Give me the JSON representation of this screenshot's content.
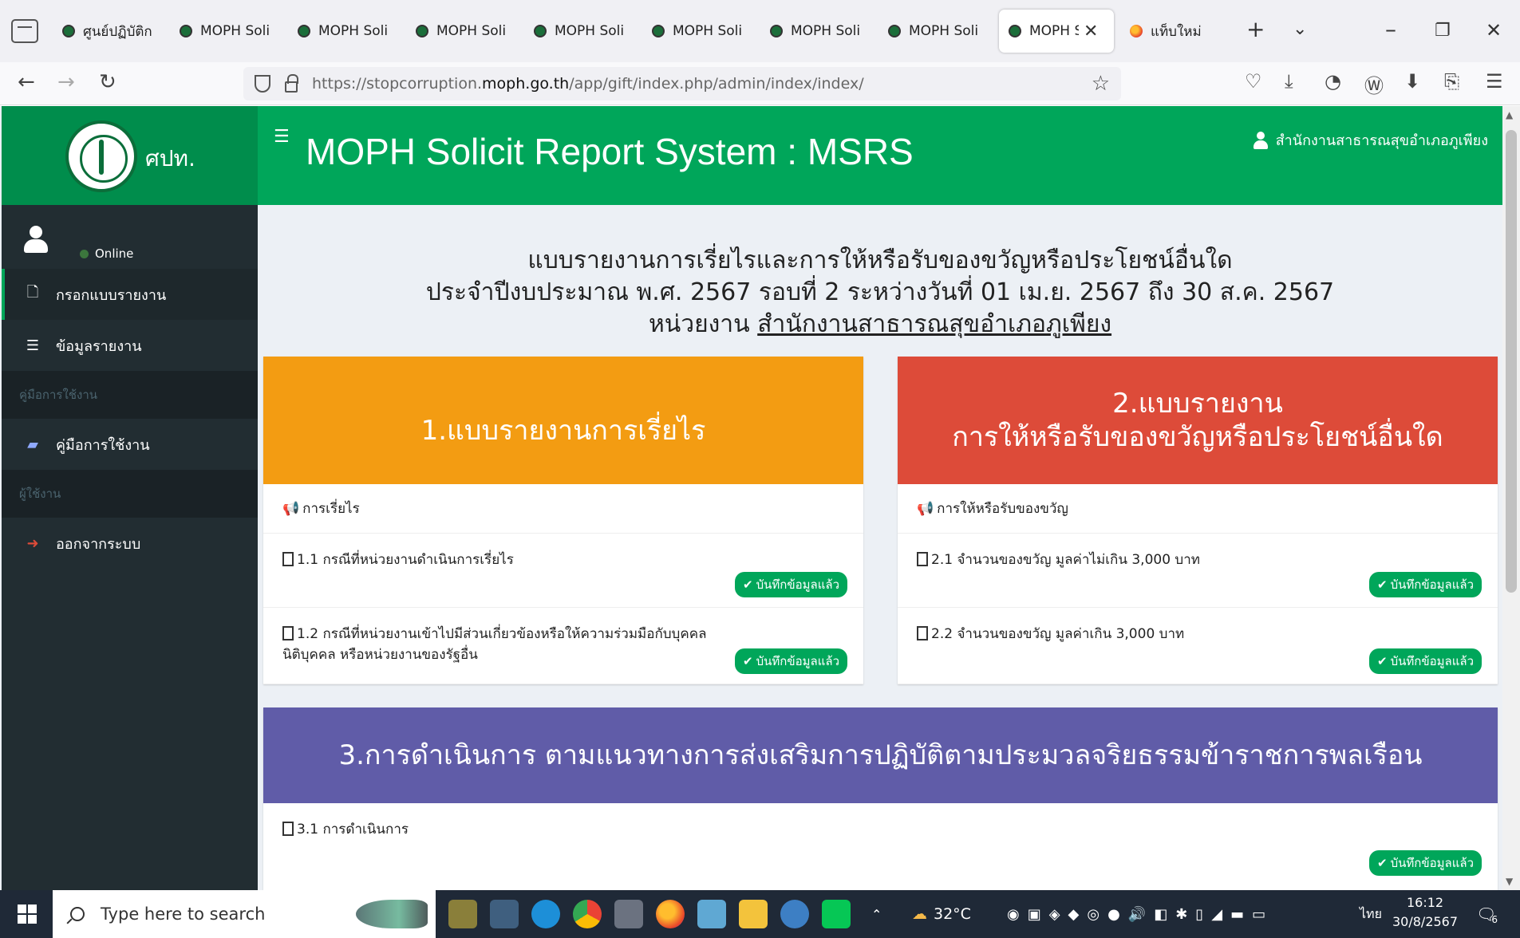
{
  "browser": {
    "tabs": [
      {
        "title": "ศูนย์ปฏิบัติการ",
        "active": false
      },
      {
        "title": "MOPH Solicit",
        "active": false
      },
      {
        "title": "MOPH Solicit",
        "active": false
      },
      {
        "title": "MOPH Solicit",
        "active": false
      },
      {
        "title": "MOPH Solicit",
        "active": false
      },
      {
        "title": "MOPH Solicit",
        "active": false
      },
      {
        "title": "MOPH Solicit",
        "active": false
      },
      {
        "title": "MOPH Solicit",
        "active": false
      },
      {
        "title": "MOPH S",
        "active": true
      },
      {
        "title": "แท็บใหม่",
        "active": false
      }
    ],
    "url_prefix": "https://stopcorruption.",
    "url_host": "moph.go.th",
    "url_path": "/app/gift/index.php/admin/index/index/"
  },
  "sidebar": {
    "logo_text": "ศปท.",
    "status": "Online",
    "items": [
      {
        "label": "กรอกแบบรายงาน",
        "icon": "file-icon",
        "active": true
      },
      {
        "label": "ข้อมูลรายงาน",
        "icon": "list-icon",
        "active": false
      }
    ],
    "section_manual": "คู่มือการใช้งาน",
    "manual_item": "คู่มือการใช้งาน",
    "section_user": "ผู้ใช้งาน",
    "logout_item": "ออกจากระบบ"
  },
  "header": {
    "title": "MOPH Solicit Report System : MSRS",
    "user": "สำนักงานสาธารณสุขอำเภอภูเพียง"
  },
  "report": {
    "line1": "แบบรายงานการเรี่ยไรและการให้หรือรับของขวัญหรือประโยชน์อื่นใด",
    "line2": "ประจำปีงบประมาณ พ.ศ. 2567 รอบที่ 2 ระหว่างวันที่ 01 เม.ย. 2567 ถึง 30 ส.ค. 2567",
    "line3_label": "หน่วยงาน",
    "line3_org": "สำนักงานสาธารณสุขอำเภอภูเพียง"
  },
  "sections": {
    "s1": {
      "title": "1.แบบรายงานการเรี่ยไร",
      "color": "#f39c12",
      "sub": "การเรี่ยไร",
      "rows": [
        {
          "text": "1.1 กรณีที่หน่วยงานดำเนินการเรี่ยไร",
          "badge": "บันทึกข้อมูลแล้ว"
        },
        {
          "text": "1.2 กรณีที่หน่วยงานเข้าไปมีส่วนเกี่ยวข้องหรือให้ความร่วมมือกับบุคคล นิติบุคคล หรือหน่วยงานของรัฐอื่น",
          "badge": "บันทึกข้อมูลแล้ว"
        }
      ]
    },
    "s2": {
      "title_line1": "2.แบบรายงาน",
      "title_line2": "การให้หรือรับของขวัญหรือประโยชน์อื่นใด",
      "color": "#dd4b39",
      "sub": "การให้หรือรับของขวัญ",
      "rows": [
        {
          "text": "2.1 จำนวนของขวัญ มูลค่าไม่เกิน 3,000 บาท",
          "badge": "บันทึกข้อมูลแล้ว"
        },
        {
          "text": "2.2 จำนวนของขวัญ มูลค่าเกิน 3,000 บาท",
          "badge": "บันทึกข้อมูลแล้ว"
        }
      ]
    },
    "s3": {
      "title": "3.การดำเนินการ ตามแนวทางการส่งเสริมการปฏิบัติตามประมวลจริยธรรมข้าราชการพลเรือน",
      "color": "#605ca8",
      "rows": [
        {
          "text": "3.1 การดำเนินการ",
          "badge": "บันทึกข้อมูลแล้ว"
        }
      ]
    }
  },
  "taskbar": {
    "search_placeholder": "Type here to search",
    "weather": "32°C",
    "lang": "ไทย",
    "time": "16:12",
    "date": "30/8/2567",
    "notification_count": "6"
  },
  "colors": {
    "header_green": "#00a65a",
    "logo_green": "#008d4c",
    "sidebar_dark": "#222d32"
  }
}
